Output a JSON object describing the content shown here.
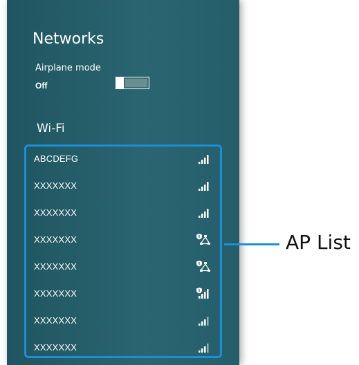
{
  "panel": {
    "title": "Networks",
    "airplane_mode": {
      "label": "Airplane mode",
      "state": "Off",
      "on": false
    },
    "wifi_heading": "Wi-Fi",
    "networks": [
      {
        "name": "ABCDEFG",
        "icon": "signal-full-icon"
      },
      {
        "name": "XXXXXXX",
        "icon": "signal-full-icon"
      },
      {
        "name": "XXXXXXX",
        "icon": "signal-full-icon"
      },
      {
        "name": "XXXXXXX",
        "icon": "shielded-network-icon"
      },
      {
        "name": "XXXXXXX",
        "icon": "shielded-network-icon"
      },
      {
        "name": "XXXXXXX",
        "icon": "shielded-signal-icon"
      },
      {
        "name": "XXXXXXX",
        "icon": "signal-weak-icon"
      },
      {
        "name": "XXXXXXX",
        "icon": "signal-weak-icon"
      }
    ]
  },
  "callout": {
    "label": "AP List",
    "color": "#1d8ed8"
  },
  "colors": {
    "panel_bg": "#2a6571",
    "text": "#ffffff"
  }
}
